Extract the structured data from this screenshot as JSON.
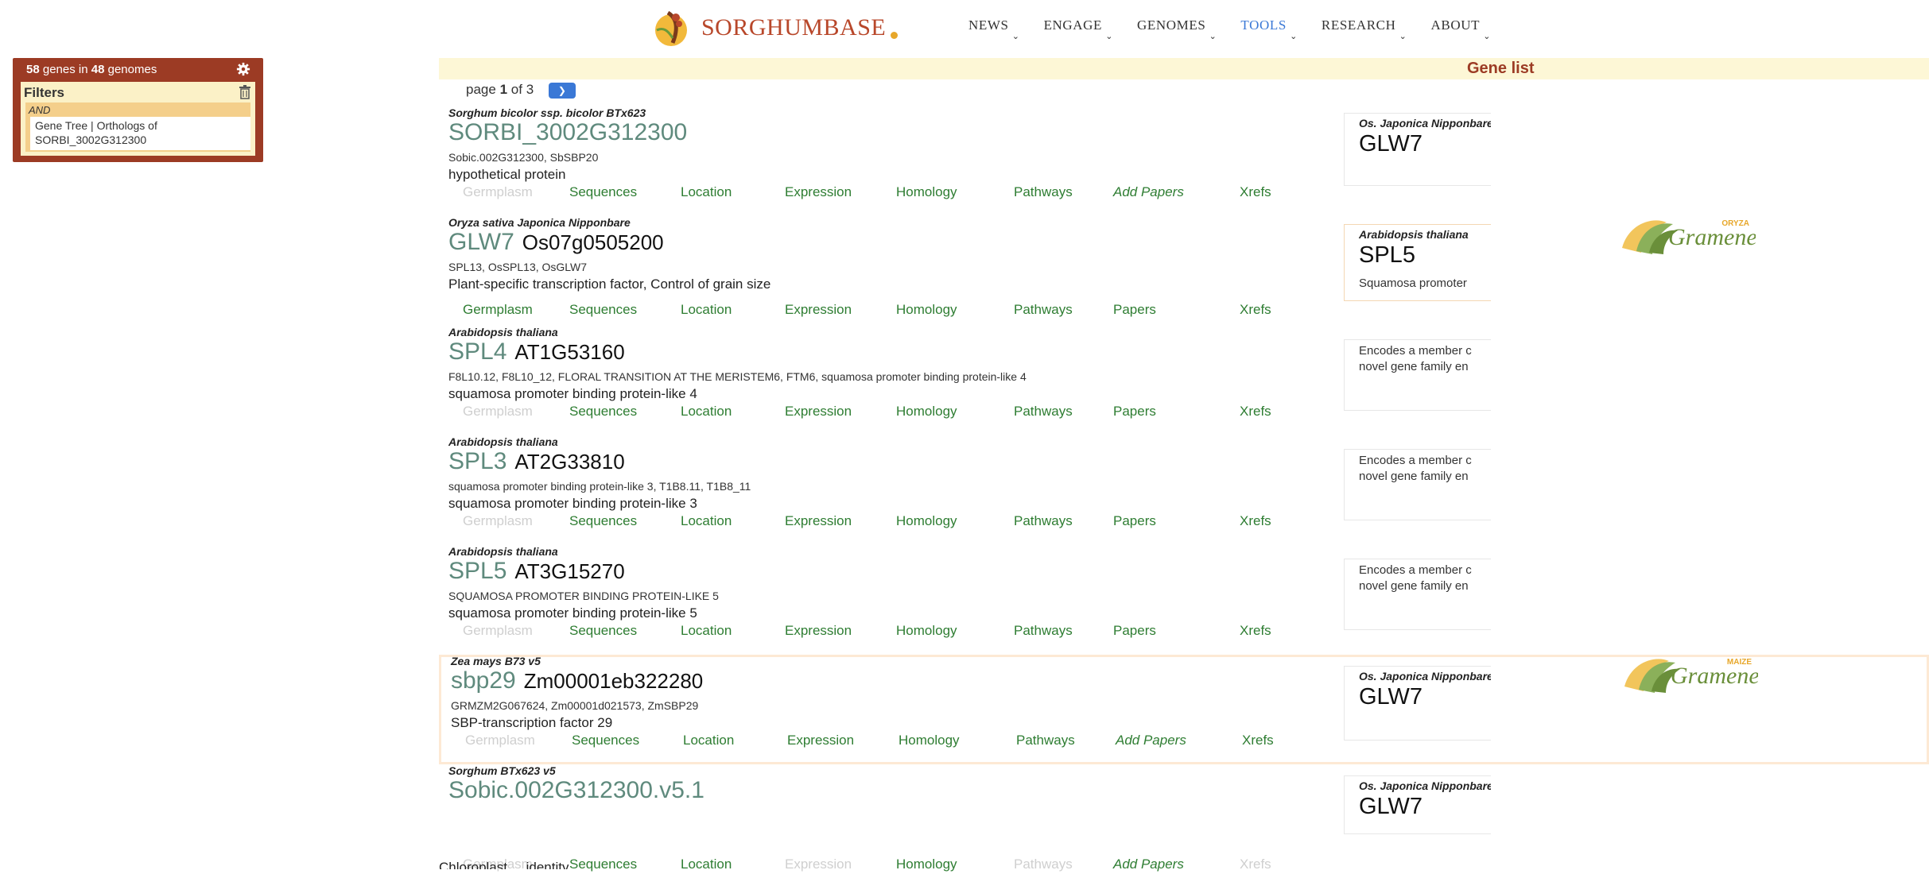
{
  "header": {
    "logo_text": "SORGHUMBASE",
    "nav": [
      {
        "label": "NEWS",
        "active": false
      },
      {
        "label": "ENGAGE",
        "active": false
      },
      {
        "label": "GENOMES",
        "active": false
      },
      {
        "label": "TOOLS",
        "active": true
      },
      {
        "label": "RESEARCH",
        "active": false
      },
      {
        "label": "ABOUT",
        "active": false
      }
    ]
  },
  "filters_panel": {
    "gene_count": "58",
    "genes_in": "genes in",
    "genome_count": "48",
    "genomes": "genomes",
    "title": "Filters",
    "operator": "AND",
    "term": "Gene Tree | Orthologs of SORBI_3002G312300"
  },
  "list": {
    "title": "Gene list",
    "pager": {
      "prefix": "page",
      "current": "1",
      "of": "of",
      "total": "3",
      "next_icon": "chevron-right-icon"
    }
  },
  "genes": [
    {
      "species": "Sorghum bicolor ssp. bicolor BTx623",
      "name": "SORBI_3002G312300",
      "id": "",
      "synonyms": "Sobic.002G312300, SbSBP20",
      "description": "hypothetical protein",
      "tabs": [
        {
          "label": "Germplasm",
          "state": "dim"
        },
        {
          "label": "Sequences",
          "state": "on"
        },
        {
          "label": "Location",
          "state": "on"
        },
        {
          "label": "Expression",
          "state": "on"
        },
        {
          "label": "Homology",
          "state": "on"
        },
        {
          "label": "Pathways",
          "state": "on"
        },
        {
          "label": "Add Papers",
          "state": "italic"
        },
        {
          "label": "Xrefs",
          "state": "on"
        }
      ],
      "gramene": null,
      "side": {
        "species": "Os. Japonica Nipponbare",
        "symbol": "GLW7",
        "text": []
      }
    },
    {
      "species": "Oryza sativa Japonica Nipponbare",
      "name": "GLW7",
      "id": "Os07g0505200",
      "synonyms": "SPL13, OsSPL13, OsGLW7",
      "description": "Plant-specific transcription factor, Control of grain size",
      "tabs": [
        {
          "label": "Germplasm",
          "state": "on"
        },
        {
          "label": "Sequences",
          "state": "on"
        },
        {
          "label": "Location",
          "state": "on"
        },
        {
          "label": "Expression",
          "state": "on"
        },
        {
          "label": "Homology",
          "state": "on"
        },
        {
          "label": "Pathways",
          "state": "on"
        },
        {
          "label": "Papers",
          "state": "on"
        },
        {
          "label": "Xrefs",
          "state": "on"
        }
      ],
      "gramene": {
        "tag": "ORYZA",
        "word": "Gramene"
      },
      "side": {
        "species": "Arabidopsis thaliana",
        "symbol": "SPL5",
        "text": [
          "Squamosa promoter"
        ]
      }
    },
    {
      "species": "Arabidopsis thaliana",
      "name": "SPL4",
      "id": "AT1G53160",
      "synonyms": "F8L10.12, F8L10_12, FLORAL TRANSITION AT THE MERISTEM6, FTM6, squamosa promoter binding protein-like 4",
      "description": "squamosa promoter binding protein-like 4",
      "tabs": [
        {
          "label": "Germplasm",
          "state": "dim"
        },
        {
          "label": "Sequences",
          "state": "on"
        },
        {
          "label": "Location",
          "state": "on"
        },
        {
          "label": "Expression",
          "state": "on"
        },
        {
          "label": "Homology",
          "state": "on"
        },
        {
          "label": "Pathways",
          "state": "on"
        },
        {
          "label": "Papers",
          "state": "on"
        },
        {
          "label": "Xrefs",
          "state": "on"
        }
      ],
      "gramene": null,
      "side": {
        "species": "",
        "symbol": "",
        "text": [
          "Encodes a member c",
          "novel gene family en"
        ]
      }
    },
    {
      "species": "Arabidopsis thaliana",
      "name": "SPL3",
      "id": "AT2G33810",
      "synonyms": "squamosa promoter binding protein-like 3, T1B8.11, T1B8_11",
      "description": "squamosa promoter binding protein-like 3",
      "tabs": [
        {
          "label": "Germplasm",
          "state": "dim"
        },
        {
          "label": "Sequences",
          "state": "on"
        },
        {
          "label": "Location",
          "state": "on"
        },
        {
          "label": "Expression",
          "state": "on"
        },
        {
          "label": "Homology",
          "state": "on"
        },
        {
          "label": "Pathways",
          "state": "on"
        },
        {
          "label": "Papers",
          "state": "on"
        },
        {
          "label": "Xrefs",
          "state": "on"
        }
      ],
      "gramene": null,
      "side": {
        "species": "",
        "symbol": "",
        "text": [
          "Encodes a member c",
          "novel gene family en"
        ]
      }
    },
    {
      "species": "Arabidopsis thaliana",
      "name": "SPL5",
      "id": "AT3G15270",
      "synonyms": "SQUAMOSA PROMOTER BINDING PROTEIN-LIKE 5",
      "description": "squamosa promoter binding protein-like 5",
      "tabs": [
        {
          "label": "Germplasm",
          "state": "dim"
        },
        {
          "label": "Sequences",
          "state": "on"
        },
        {
          "label": "Location",
          "state": "on"
        },
        {
          "label": "Expression",
          "state": "on"
        },
        {
          "label": "Homology",
          "state": "on"
        },
        {
          "label": "Pathways",
          "state": "on"
        },
        {
          "label": "Papers",
          "state": "on"
        },
        {
          "label": "Xrefs",
          "state": "on"
        }
      ],
      "gramene": null,
      "side": {
        "species": "",
        "symbol": "",
        "text": [
          "Encodes a member c",
          "novel gene family en"
        ]
      }
    },
    {
      "species": "Zea mays B73 v5",
      "name": "sbp29",
      "id": "Zm00001eb322280",
      "synonyms": "GRMZM2G067624, Zm00001d021573, ZmSBP29",
      "description": "SBP-transcription factor 29",
      "tabs": [
        {
          "label": "Germplasm",
          "state": "dim"
        },
        {
          "label": "Sequences",
          "state": "on"
        },
        {
          "label": "Location",
          "state": "on"
        },
        {
          "label": "Expression",
          "state": "on"
        },
        {
          "label": "Homology",
          "state": "on"
        },
        {
          "label": "Pathways",
          "state": "on"
        },
        {
          "label": "Add Papers",
          "state": "italic"
        },
        {
          "label": "Xrefs",
          "state": "on"
        }
      ],
      "gramene": {
        "tag": "MAIZE",
        "word": "Gramene"
      },
      "side": {
        "species": "Os. Japonica Nipponbare",
        "symbol": "GLW7",
        "text": []
      }
    },
    {
      "species": "Sorghum BTx623 v5",
      "name": "Sobic.002G312300.v5.1",
      "id": "",
      "synonyms": "",
      "description": "",
      "tabs": [
        {
          "label": "Germplasm",
          "state": "dim"
        },
        {
          "label": "Sequences",
          "state": "on"
        },
        {
          "label": "Location",
          "state": "on"
        },
        {
          "label": "Expression",
          "state": "dim"
        },
        {
          "label": "Homology",
          "state": "on"
        },
        {
          "label": "Pathways",
          "state": "dim"
        },
        {
          "label": "Add Papers",
          "state": "italic"
        },
        {
          "label": "Xrefs",
          "state": "dim"
        }
      ],
      "gramene": null,
      "side": {
        "species": "Os. Japonica Nipponbare",
        "symbol": "GLW7",
        "text": []
      }
    }
  ],
  "cutoff_text": "Chloroplast ... identity",
  "colors": {
    "brand": "#9c3b24",
    "accent": "#3a78d6",
    "link": "#2e7d32",
    "gene_name": "#5f8a7d"
  }
}
